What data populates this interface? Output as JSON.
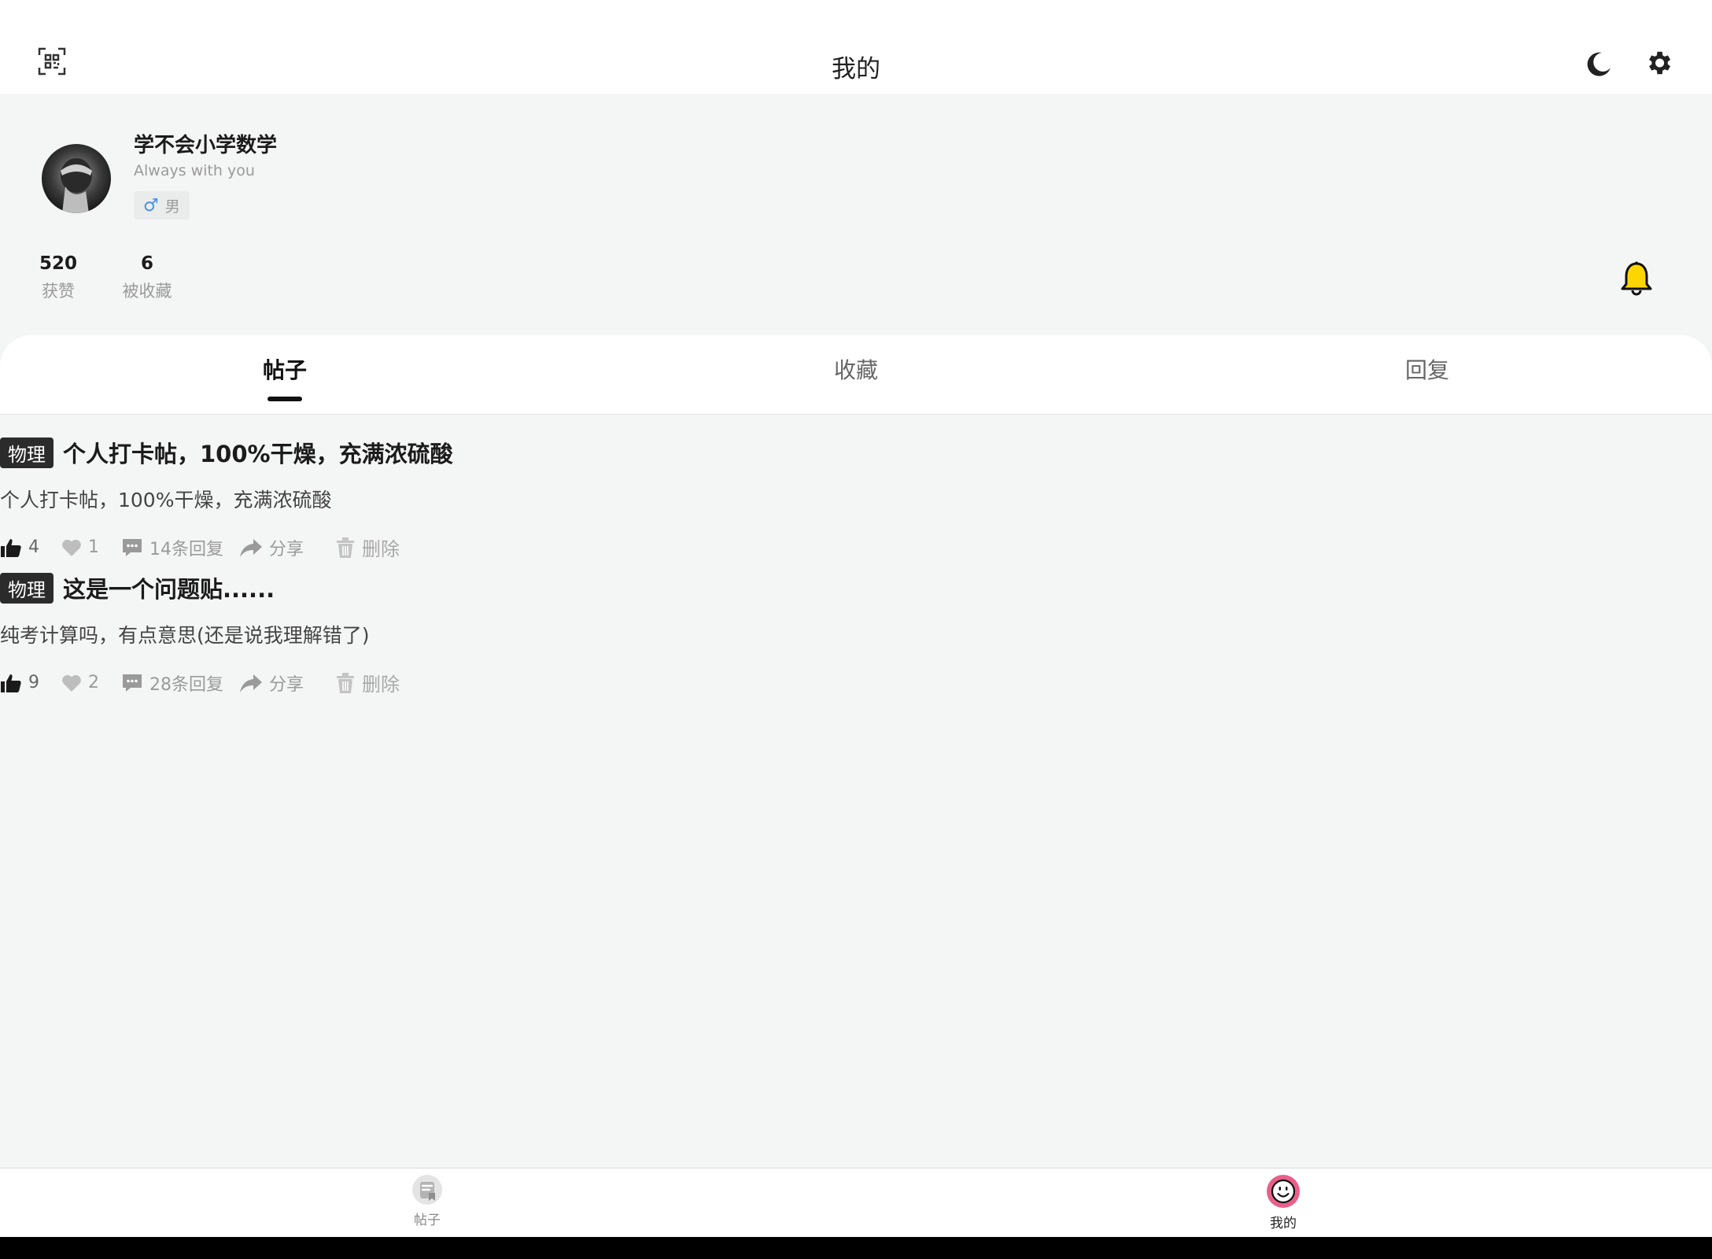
{
  "header": {
    "title": "我的"
  },
  "profile": {
    "username": "学不会小学数学",
    "motto": "Always  with you",
    "gender_symbol": "♂",
    "gender": "男"
  },
  "stats": [
    {
      "value": "520",
      "label": "获赞"
    },
    {
      "value": "6",
      "label": "被收藏"
    }
  ],
  "tabs": [
    {
      "label": "帖子",
      "active": true
    },
    {
      "label": "收藏",
      "active": false
    },
    {
      "label": "回复",
      "active": false
    }
  ],
  "posts": [
    {
      "tag": "物理",
      "title": "个人打卡帖，100%干燥，充满浓硫酸",
      "body": "个人打卡帖，100%干燥，充满浓硫酸",
      "likes": "4",
      "favorites": "1",
      "replies": "14条回复",
      "share": "分享",
      "delete": "删除"
    },
    {
      "tag": "物理",
      "title": "这是一个问题贴......",
      "body": "纯考计算吗，有点意思(还是说我理解错了)",
      "likes": "9",
      "favorites": "2",
      "replies": "28条回复",
      "share": "分享",
      "delete": "删除"
    }
  ],
  "bottom_nav": [
    {
      "label": "帖子",
      "icon": "post-icon",
      "active": false
    },
    {
      "label": "我的",
      "icon": "smiley-icon",
      "active": true
    }
  ],
  "colors": {
    "bell": "#ffd500",
    "avatar_ring": "#e8608a",
    "background": "#f4f6f5"
  }
}
